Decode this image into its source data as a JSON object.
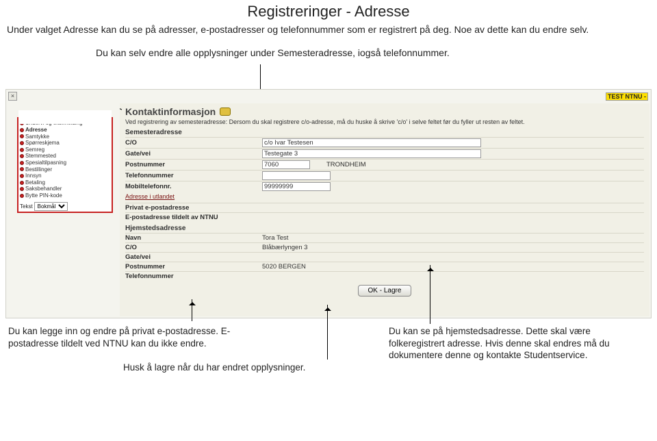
{
  "title": "Registreringer - Adresse",
  "intro1": "Under valget Adresse kan du se på adresser, e-postadresser og telefonnummer som er registrert på deg. Noe av dette kan du endre selv.",
  "intro2": "Du kan selv endre alle opplysninger under Semesteradresse, iogså telefonnummer.",
  "tag": "TEST  NTNU -",
  "close": "×",
  "sidebar": {
    "items": [
      "Underv. og eks.melding",
      "Adresse",
      "Samtykke",
      "Spørreskjema",
      "Semreg",
      "Stemmested",
      "Spesialtilpasning",
      "Bestillinger",
      "Innsyn",
      "Betaling",
      "Saksbehandler",
      "Bytte PIN-kode"
    ],
    "langLabel": "Tekst",
    "langValue": "Bokmål"
  },
  "main": {
    "heading": "Kontaktinformasjon",
    "instruction": "Ved registrering av semesteradresse: Dersom du skal registrere c/o-adresse, må du huske å skrive 'c/o' i selve feltet før du fyller ut resten av feltet.",
    "sem": {
      "title": "Semesteradresse",
      "co": {
        "label": "C/O",
        "value": "c/o Ivar Testesen"
      },
      "gate": {
        "label": "Gate/vei",
        "value": "Testegate 3"
      },
      "postnr": {
        "label": "Postnummer",
        "value": "7060",
        "city": "TRONDHEIM"
      },
      "tlf": {
        "label": "Telefonnummer",
        "value": ""
      },
      "mob": {
        "label": "Mobiltelefonnr.",
        "value": "99999999"
      },
      "utland": "Adresse i utlandet"
    },
    "epost": {
      "priv": "Privat e-postadresse",
      "ntnu": "E-postadresse tildelt av NTNU"
    },
    "hjem": {
      "title": "Hjemstedsadresse",
      "navn": {
        "label": "Navn",
        "value": "Tora Test"
      },
      "co": {
        "label": "C/O",
        "value": "Blåbærlyngen 3"
      },
      "gate": {
        "label": "Gate/vei",
        "value": ""
      },
      "postnr": {
        "label": "Postnummer",
        "value": "5020 BERGEN"
      },
      "tlf": {
        "label": "Telefonnummer",
        "value": ""
      }
    },
    "okBtn": "OK - Lagre"
  },
  "notes": {
    "left": "Du kan legge inn og endre på privat e-postadresse. E-postadresse tildelt ved NTNU kan du ikke endre.",
    "right": "Du kan se på hjemstedsadresse. Dette skal være folkeregistrert adresse. Hvis denne skal endres må du dokumentere denne og kontakte Studentservice.",
    "husk": "Husk å lagre når du har endret opplysninger."
  }
}
